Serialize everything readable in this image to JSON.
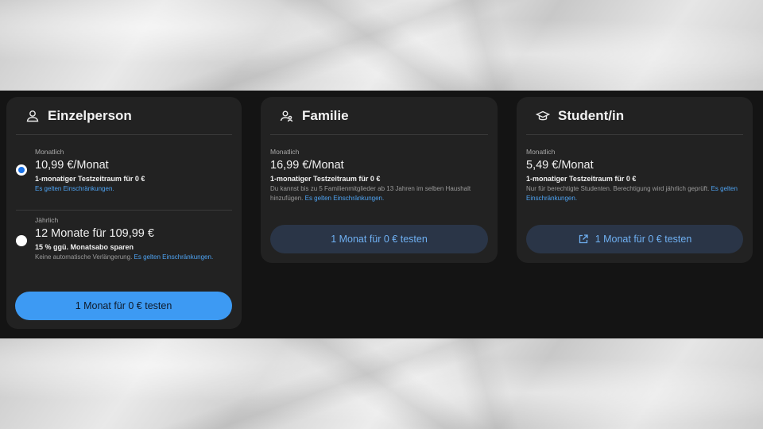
{
  "plans": [
    {
      "title": "Einzelperson",
      "icon": "person-icon",
      "options": [
        {
          "period_label": "Monatlich",
          "price": "10,99 €/Monat",
          "headline": "1-monatiger Testzeitraum für 0 €",
          "note": "",
          "link": "Es gelten Einschränkungen.",
          "selected": true
        },
        {
          "period_label": "Jährlich",
          "price": "12 Monate für 109,99 €",
          "headline": "15 % ggü. Monatsabo sparen",
          "note": "Keine automatische Verlängerung.",
          "link": "Es gelten Einschränkungen.",
          "selected": false
        }
      ],
      "button_label": "1 Monat für 0 € testen"
    },
    {
      "title": "Familie",
      "icon": "family-icon",
      "period_label": "Monatlich",
      "price": "16,99 €/Monat",
      "headline": "1-monatiger Testzeitraum für 0 €",
      "note": "Du kannst bis zu 5 Familienmitglieder ab 13 Jahren im selben Haushalt hinzufügen.",
      "link": "Es gelten Einschränkungen.",
      "button_label": "1 Monat für 0 € testen"
    },
    {
      "title": "Student/in",
      "icon": "graduation-cap-icon",
      "period_label": "Monatlich",
      "price": "5,49 €/Monat",
      "headline": "1-monatiger Testzeitraum für 0 €",
      "note": "Nur für berechtigte Studenten. Berechtigung wird jährlich geprüft.",
      "link": "Es gelten Einschränkungen.",
      "button_label": "1 Monat für 0 € testen",
      "button_icon": "external-link-icon"
    }
  ],
  "colors": {
    "accent": "#3d9af3",
    "link": "#4ea3f2",
    "card_bg": "#222222",
    "page_bg": "#141414",
    "radio_selected": "#1a73e8"
  }
}
